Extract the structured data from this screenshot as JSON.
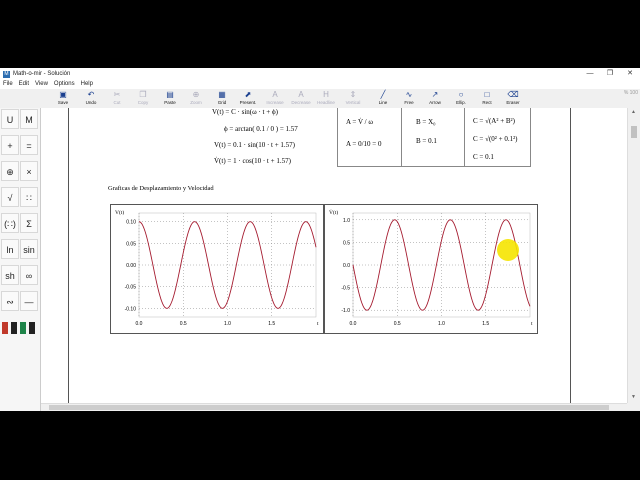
{
  "window": {
    "title": "Math-o-mir - Solución",
    "controls": {
      "minimize": "—",
      "maximize": "❐",
      "close": "✕"
    }
  },
  "menu": [
    "File",
    "Edit",
    "View",
    "Options",
    "Help"
  ],
  "toolbar": [
    {
      "label": "Save",
      "icon": "save-icon",
      "glyph": "▣",
      "enabled": true
    },
    {
      "label": "Undo",
      "icon": "undo-icon",
      "glyph": "↶",
      "enabled": true
    },
    {
      "label": "Cut",
      "icon": "cut-icon",
      "glyph": "✂",
      "enabled": false
    },
    {
      "label": "Copy",
      "icon": "copy-icon",
      "glyph": "❐",
      "enabled": false
    },
    {
      "label": "Paste",
      "icon": "paste-icon",
      "glyph": "▤",
      "enabled": true
    },
    {
      "label": "Zoom",
      "icon": "zoom-icon",
      "glyph": "⊕",
      "enabled": false
    },
    {
      "label": "Grid",
      "icon": "grid-icon",
      "glyph": "▦",
      "enabled": true
    },
    {
      "label": "Present.",
      "icon": "presentation-icon",
      "glyph": "⬈",
      "enabled": true
    },
    {
      "label": "Increase",
      "icon": "increase-icon",
      "glyph": "A",
      "enabled": false
    },
    {
      "label": "Decrease",
      "icon": "decrease-icon",
      "glyph": "A",
      "enabled": false
    },
    {
      "label": "Headline",
      "icon": "headline-icon",
      "glyph": "H",
      "enabled": false
    },
    {
      "label": "Vertical",
      "icon": "vertical-icon",
      "glyph": "⇕",
      "enabled": false
    },
    {
      "label": "Line",
      "icon": "line-icon",
      "glyph": "╱",
      "enabled": true
    },
    {
      "label": "Free",
      "icon": "freehand-icon",
      "glyph": "∿",
      "enabled": true
    },
    {
      "label": "Arrow",
      "icon": "arrow-icon",
      "glyph": "↗",
      "enabled": true
    },
    {
      "label": "Ellip.",
      "icon": "ellipse-icon",
      "glyph": "○",
      "enabled": true
    },
    {
      "label": "Rect",
      "icon": "rectangle-icon",
      "glyph": "□",
      "enabled": true
    },
    {
      "label": "Eraser",
      "icon": "eraser-icon",
      "glyph": "⌫",
      "enabled": true
    }
  ],
  "zoom_label": "% 100",
  "palette": [
    [
      "U",
      "M"
    ],
    [
      "+",
      "="
    ],
    [
      "⊕",
      "×"
    ],
    [
      "√",
      "∷"
    ],
    [
      "(∷)",
      "Σ"
    ],
    [
      "ln",
      "sin"
    ],
    [
      "sh",
      "∞"
    ],
    [
      "∾",
      "—"
    ]
  ],
  "equations": {
    "e1": "V(t) = C · sin(ω · t + ϕ)",
    "e2": "ϕ = arctan( 0.1 / 0 ) = 1.57",
    "e3": "V(t) = 0.1 · sin(10 · t + 1.57)",
    "e4": "V̇(t) = 1 · cos(10 · t + 1.57)"
  },
  "abc": {
    "a1": "A = V̇ / ω",
    "a2": "A = 0/10 = 0",
    "b1": "B = X₀",
    "b2": "B = 0.1",
    "c1": "C = √(A² + B²)",
    "c2": "C = √(0² + 0.1²)",
    "c3": "C = 0.1"
  },
  "heading": "Graficas de Desplazamiento y Velocidad",
  "chart_data": [
    {
      "type": "line",
      "ylabel": "V(t)",
      "xlabel": "t",
      "xlim": [
        0,
        2
      ],
      "ylim": [
        -0.12,
        0.12
      ],
      "xticks": [
        "0.0",
        "0.5",
        "1.0",
        "1.5"
      ],
      "yticks": [
        "0.10",
        "0.05",
        "0.00",
        "-0.05",
        "-0.10"
      ],
      "ytick_values": [
        0.1,
        0.05,
        0,
        -0.05,
        -0.1
      ],
      "function": "0.1 * sin(10*t + 1.57)",
      "amplitude": 0.1,
      "omega": 10,
      "phase": 1.57,
      "trig": "sin",
      "color": "#a51c30"
    },
    {
      "type": "line",
      "ylabel": "V̇(t)",
      "xlabel": "t",
      "xlim": [
        0,
        2
      ],
      "ylim": [
        -1.15,
        1.15
      ],
      "xticks": [
        "0.0",
        "0.5",
        "1.0",
        "1.5"
      ],
      "yticks": [
        "1.0",
        "0.5",
        "0.0",
        "-0.5",
        "-1.0"
      ],
      "ytick_values": [
        1,
        0.5,
        0,
        -0.5,
        -1
      ],
      "function": "1 * cos(10*t + 1.57)",
      "amplitude": 1,
      "omega": 10,
      "phase": 1.57,
      "trig": "cos",
      "color": "#a51c30"
    }
  ]
}
